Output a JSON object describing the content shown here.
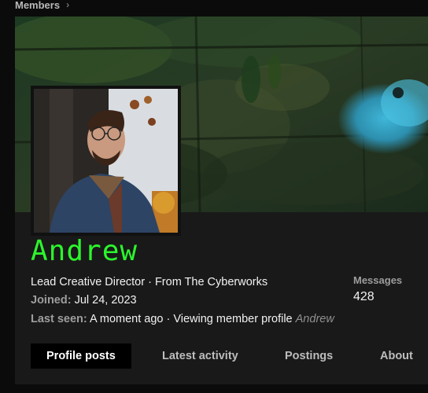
{
  "breadcrumb": {
    "label": "Members",
    "separator": "›"
  },
  "profile": {
    "username": "Andrew",
    "username_color": "#2cf52c",
    "title_line": "Lead Creative Director · From The Cyberworks",
    "joined_label": "Joined:",
    "joined_value": "Jul 24, 2023",
    "last_seen_label": "Last seen:",
    "last_seen_value": "A moment ago · Viewing member profile",
    "last_seen_target": "Andrew"
  },
  "stats": {
    "messages_label": "Messages",
    "messages_value": "428"
  },
  "tabs": [
    {
      "label": "Profile posts",
      "active": true
    },
    {
      "label": "Latest activity",
      "active": false
    },
    {
      "label": "Postings",
      "active": false
    },
    {
      "label": "About",
      "active": false
    }
  ],
  "icons": {
    "breadcrumb_separator": "chevron-right-icon"
  }
}
